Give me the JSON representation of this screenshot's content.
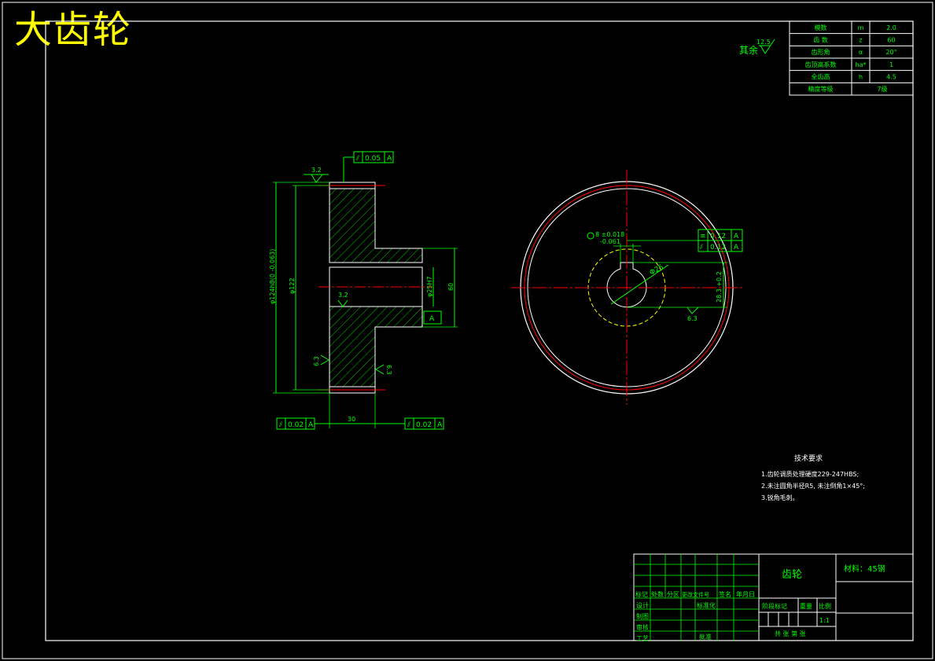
{
  "title": "大齿轮",
  "rest_roughness": {
    "label": "其余",
    "value": "12.5"
  },
  "params": [
    {
      "name": "模数",
      "sym": "m",
      "val": "2.0"
    },
    {
      "name": "齿  数",
      "sym": "z",
      "val": "60"
    },
    {
      "name": "齿形角",
      "sym": "α",
      "val": "20°"
    },
    {
      "name": "齿顶高系数",
      "sym": "ha*",
      "val": "1"
    },
    {
      "name": "全齿高",
      "sym": "h",
      "val": "4.5"
    },
    {
      "name": "精度等级",
      "sym": "",
      "val": "7级"
    }
  ],
  "section_view": {
    "roughness_top": "3.2",
    "tol_top": {
      "sym": "⫽",
      "val": "0.05",
      "datum": "A"
    },
    "od_dim": "φ124h8(0 -0.063)",
    "pitch_dim": "φ122",
    "bore_dim": "φ25H7",
    "hub_dim": "60",
    "width_dim": "30",
    "roughness_bore": "3.2",
    "roughness_left": "6.3",
    "roughness_right": "6.3",
    "datum": "A",
    "tol_left": {
      "sym": "⫽",
      "val": "0.02",
      "datum": "A"
    },
    "tol_right": {
      "sym": "⫽",
      "val": "0.02",
      "datum": "A"
    }
  },
  "front_view": {
    "keyway_width": "8 ±0.018",
    "keyway_tol2": "-0.061",
    "bore_dia": "Φ25",
    "keyway_depth": "28.3 +0.2",
    "roughness": "6.3",
    "tol1": {
      "sym": "≡",
      "val": "0.12",
      "datum": "A"
    },
    "tol2": {
      "sym": "⫽",
      "val": "0.12",
      "datum": "A"
    }
  },
  "tech_req": {
    "title": "技术要求",
    "items": [
      "1.齿轮调质处理硬度229-247HBS;",
      "2.未注圆角半径R5, 未注倒角1×45°;",
      "3.锐角毛刺。"
    ]
  },
  "title_block": {
    "part_name": "齿轮",
    "material": "材料：45钢",
    "header_row": [
      "标记",
      "处数",
      "分区",
      "更改文件号",
      "签名",
      "年月日"
    ],
    "rows": [
      "设计",
      "制图",
      "审核",
      "工艺"
    ],
    "standard": "标准化",
    "approve": "批准",
    "stage_labels": [
      "阶段标记",
      "重量",
      "比例"
    ],
    "scale": "1:1",
    "sheets": "共  张  第  张"
  }
}
